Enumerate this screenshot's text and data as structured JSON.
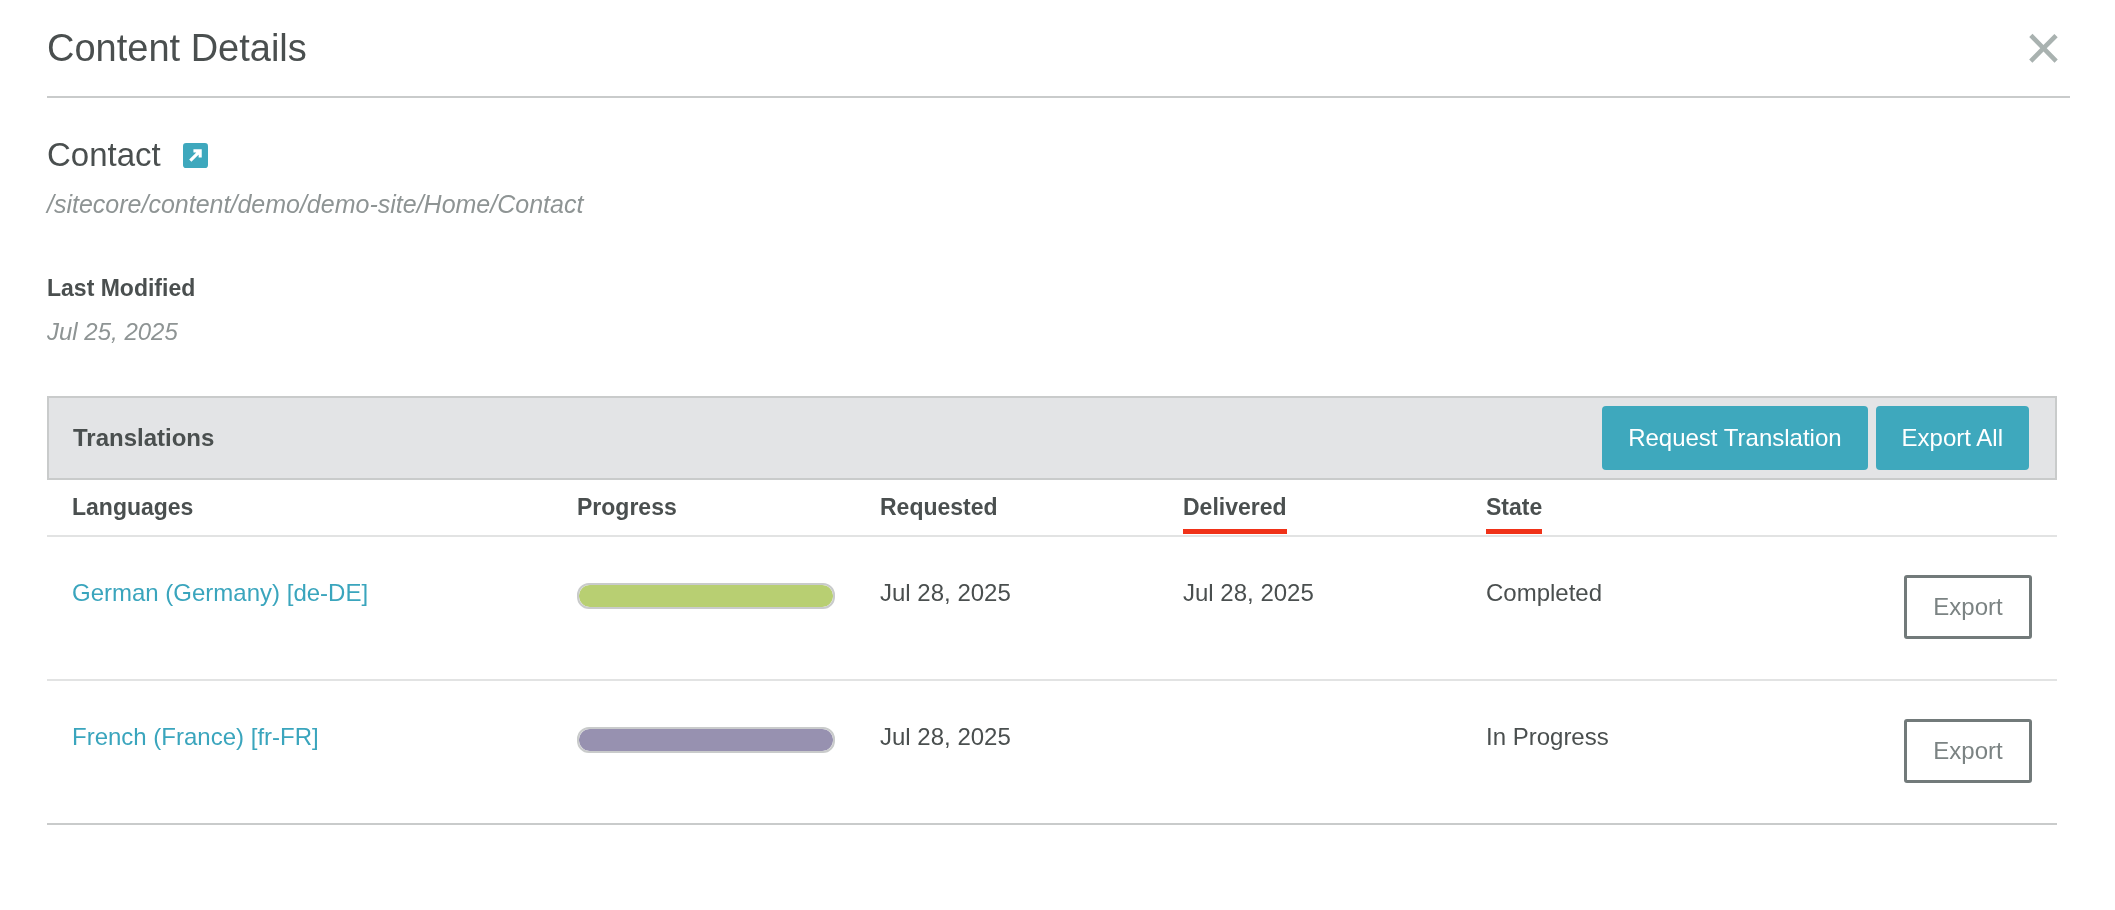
{
  "dialog": {
    "title": "Content Details",
    "close_label": "×"
  },
  "item": {
    "name": "Contact",
    "path": "/sitecore/content/demo/demo-site/Home/Contact"
  },
  "last_modified": {
    "label": "Last Modified",
    "value": "Jul 25, 2025"
  },
  "translations": {
    "title": "Translations",
    "buttons": [
      "Request Translation",
      "Export All"
    ],
    "columns": [
      {
        "label": "Languages",
        "marked": false
      },
      {
        "label": "Progress",
        "marked": false
      },
      {
        "label": "Requested",
        "marked": false
      },
      {
        "label": "Delivered",
        "marked": true
      },
      {
        "label": "State",
        "marked": true
      }
    ],
    "rows": [
      {
        "language": "German (Germany) [de-DE]",
        "level": 1,
        "color": "#b8cf72",
        "requested": "Jul 28, 2025",
        "delivered": "Jul 28, 2025",
        "state": "Completed",
        "action": "Export"
      },
      {
        "language": "French (France) [fr-FR]",
        "level": 1,
        "color": "#9791b0",
        "requested": "Jul 28, 2025",
        "state": "In Progress",
        "action": "Export"
      }
    ]
  }
}
